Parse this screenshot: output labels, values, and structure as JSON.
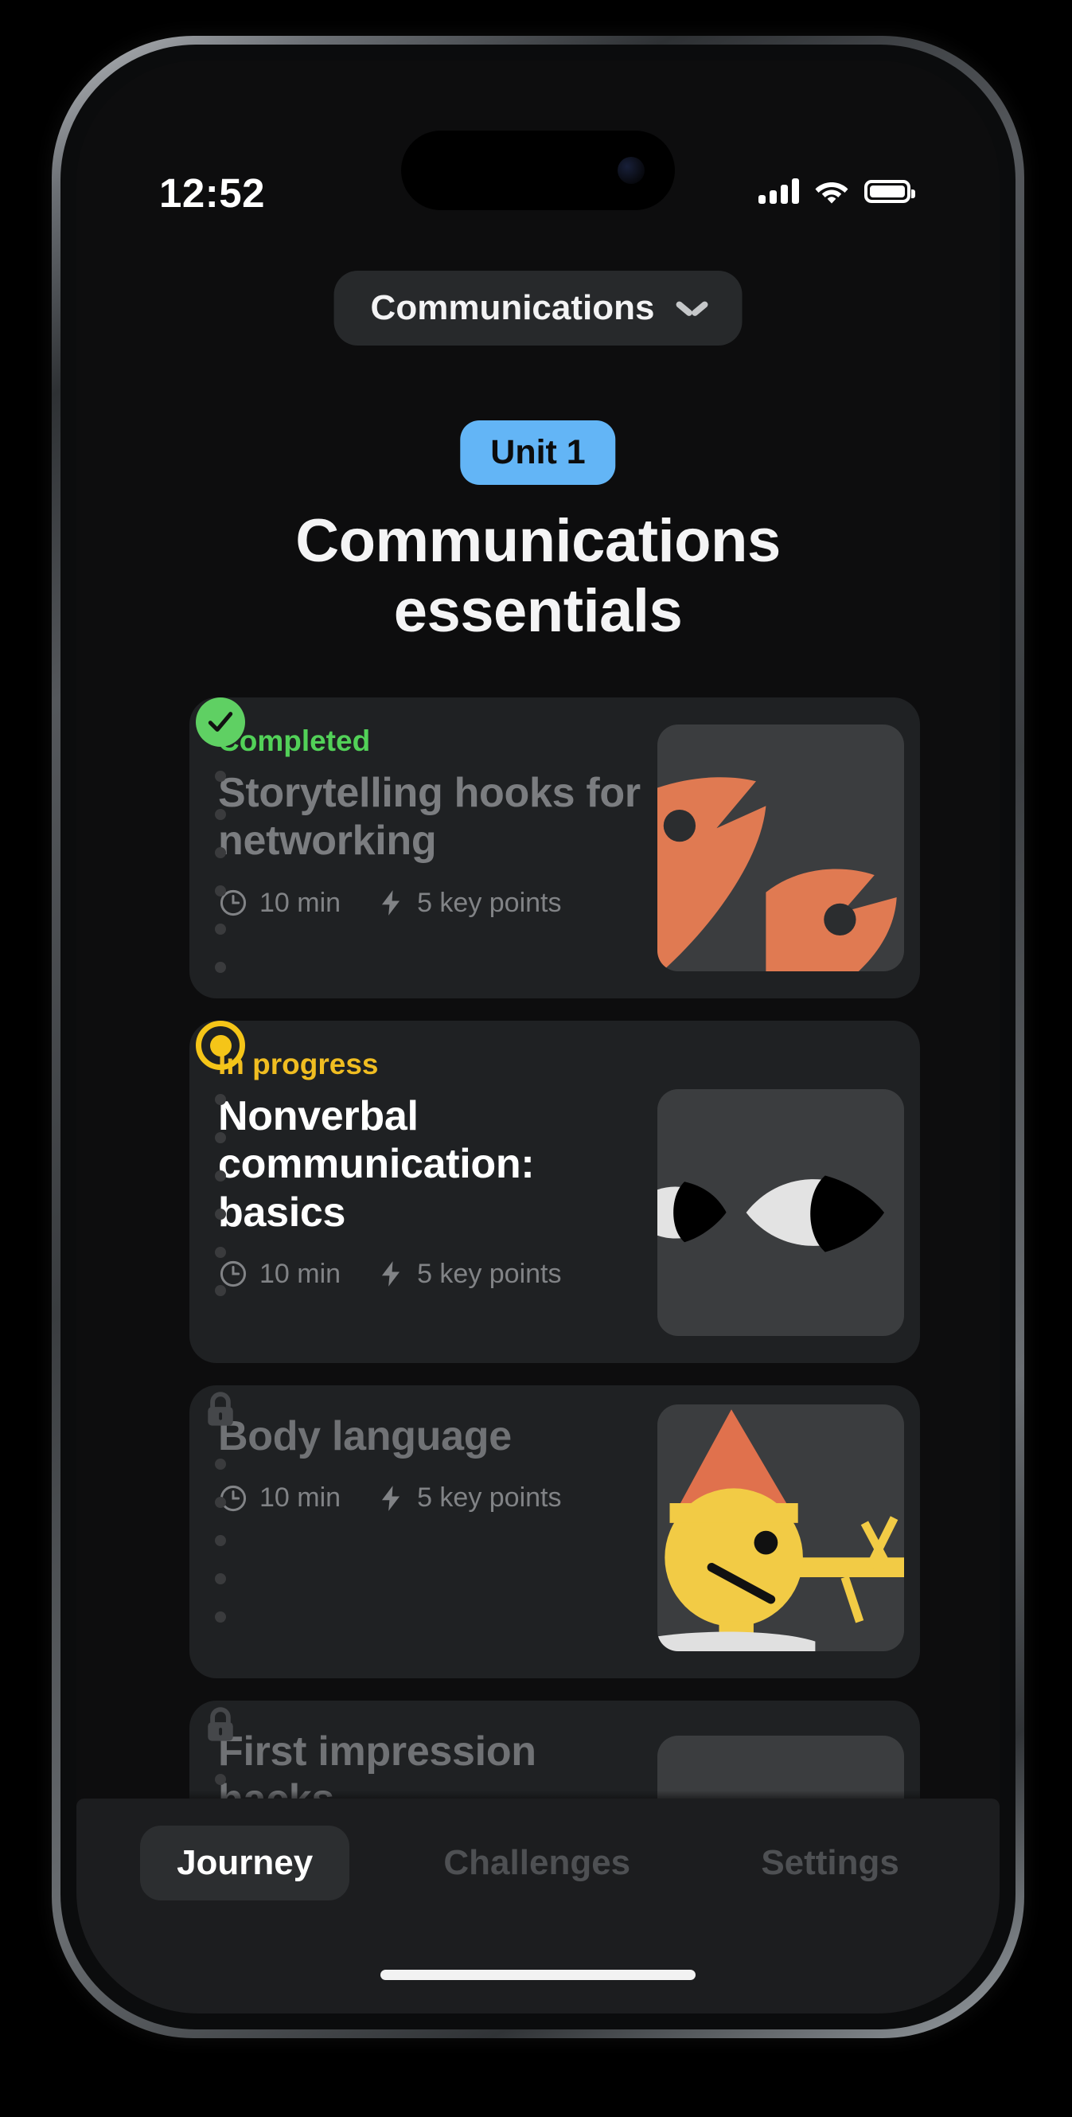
{
  "status_bar": {
    "time": "12:52",
    "cellular_icon": "cellular-signal-icon",
    "wifi_icon": "wifi-icon",
    "battery_icon": "battery-full-icon"
  },
  "header": {
    "course_selector_label": "Communications",
    "chevron_icon": "chevron-down-icon"
  },
  "unit": {
    "badge": "Unit 1",
    "title": "Communications essentials",
    "badge_color": "#63b5f6"
  },
  "colors": {
    "completed": "#52d158",
    "in_progress": "#f0bd21",
    "accent_blue": "#63b5f6",
    "card_bg": "#1f2123",
    "screen_bg": "#0d0d0e",
    "thumb_bg": "#3b3d3f",
    "orange": "#e07a52",
    "yellow": "#f2cb45"
  },
  "lessons": [
    {
      "node": "completed",
      "status": "Completed",
      "title": "Storytelling hooks for networking",
      "duration": "10 min",
      "key_points": "5 key points",
      "clock_icon": "clock-icon",
      "bolt_icon": "lightning-bolt-icon",
      "thumb": "two-orange-speech-shapes"
    },
    {
      "node": "in_progress",
      "status": "In progress",
      "title": "Nonverbal communication: basics",
      "duration": "10 min",
      "key_points": "5 key points",
      "clock_icon": "clock-icon",
      "bolt_icon": "lightning-bolt-icon",
      "thumb": "two-eyes"
    },
    {
      "node": "locked",
      "status": "",
      "title": "Body language",
      "duration": "10 min",
      "key_points": "5 key points",
      "clock_icon": "clock-icon",
      "bolt_icon": "lightning-bolt-icon",
      "thumb": "yellow-figure-cone-hat"
    },
    {
      "node": "locked",
      "status": "",
      "title": "First impression hacks",
      "duration": "",
      "key_points": "",
      "clock_icon": "clock-icon",
      "bolt_icon": "lightning-bolt-icon",
      "thumb": "empty-placeholder"
    }
  ],
  "tabbar": {
    "tabs": [
      {
        "label": "Journey",
        "active": true
      },
      {
        "label": "Challenges",
        "active": false
      },
      {
        "label": "Settings",
        "active": false
      }
    ]
  }
}
